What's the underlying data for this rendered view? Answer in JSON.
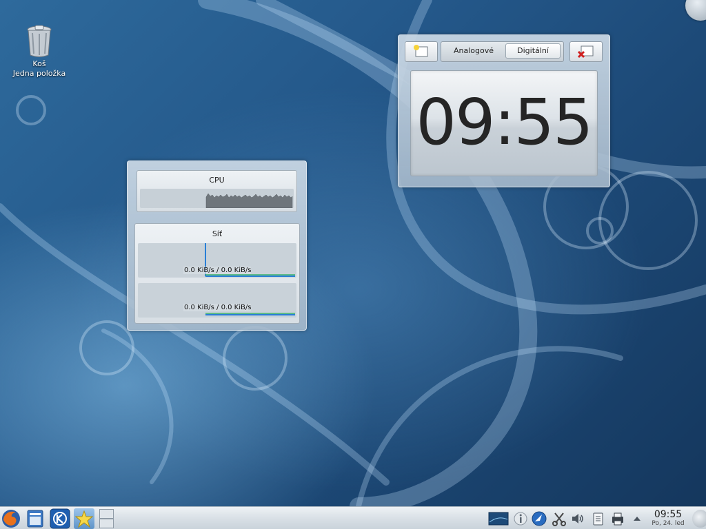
{
  "desktop": {
    "trash": {
      "name": "Koš",
      "subtitle": "Jedna položka"
    }
  },
  "clock_applet": {
    "tabs": [
      "Analogové",
      "Digitální"
    ],
    "selected_tab": "Digitální",
    "time": "09:55"
  },
  "system_monitor": {
    "cpu": {
      "title": "CPU"
    },
    "network": {
      "title": "Síť",
      "interfaces": [
        {
          "rate": "0.0 KiB/s / 0.0 KiB/s"
        },
        {
          "rate": "0.0 KiB/s / 0.0 KiB/s"
        }
      ]
    }
  },
  "taskbar": {
    "launchers": [
      "firefox-icon",
      "file-manager-icon",
      "kde-menu-icon",
      "favorites-icon"
    ],
    "tray_icons": [
      "desktop-preview-icon",
      "info-icon",
      "network-manager-icon",
      "klipper-icon",
      "volume-icon",
      "clipboard-icon",
      "printer-icon",
      "tray-expand-icon"
    ],
    "clock": {
      "time": "09:55",
      "date": "Po, 24. led"
    }
  },
  "colors": {
    "wallpaper_dark": "#14365c",
    "wallpaper_light": "#8cc8f0",
    "net_in_line": "#2a7fd6",
    "net_out_line": "#3bb36a"
  }
}
